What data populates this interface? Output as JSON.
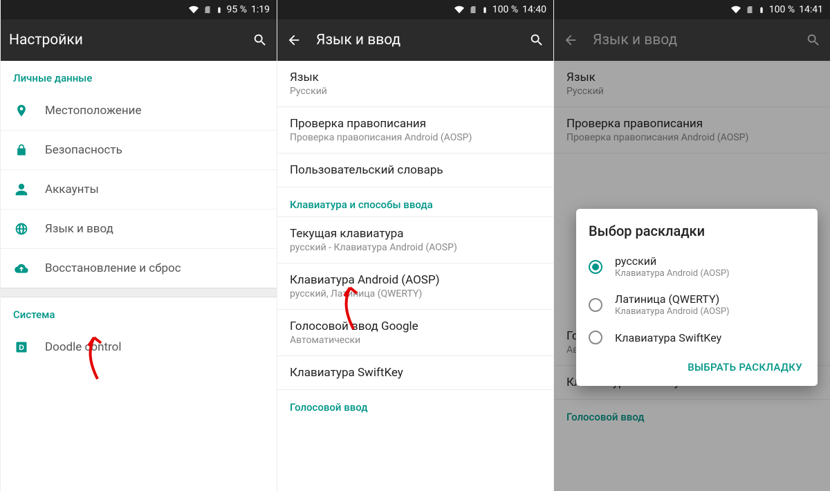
{
  "colors": {
    "accent": "#009688"
  },
  "screens": [
    {
      "status": {
        "battery": "95 %",
        "time": "1:19"
      },
      "appbar": {
        "title": "Настройки",
        "has_back": false
      },
      "section1_header": "Личные данные",
      "items1": [
        {
          "icon": "location",
          "label": "Местоположение"
        },
        {
          "icon": "lock",
          "label": "Безопасность"
        },
        {
          "icon": "account",
          "label": "Аккаунты"
        },
        {
          "icon": "globe",
          "label": "Язык и ввод"
        },
        {
          "icon": "backup",
          "label": "Восстановление и сброс"
        }
      ],
      "section2_header": "Система",
      "items2": [
        {
          "icon": "doodle",
          "label": "Doodle control"
        }
      ]
    },
    {
      "status": {
        "battery": "100 %",
        "time": "14:40"
      },
      "appbar": {
        "title": "Язык и ввод",
        "has_back": true
      },
      "prefs": [
        {
          "title": "Язык",
          "sub": "Русский"
        },
        {
          "title": "Проверка правописания",
          "sub": "Проверка правописания Android (AOSP)"
        },
        {
          "title": "Пользовательский словарь",
          "sub": ""
        }
      ],
      "section_kbd": "Клавиатура и способы ввода",
      "kbd_prefs": [
        {
          "title": "Текущая клавиатура",
          "sub": "русский - Клавиатура Android (AOSP)"
        },
        {
          "title": "Клавиатура Android (AOSP)",
          "sub": "русский, Латиница (QWERTY)"
        },
        {
          "title": "Голосовой ввод Google",
          "sub": "Автоматически"
        },
        {
          "title": "Клавиатура SwiftKey",
          "sub": ""
        }
      ],
      "bottom_header": "Голосовой ввод"
    },
    {
      "status": {
        "battery": "100 %",
        "time": "14:41"
      },
      "appbar": {
        "title": "Язык и ввод",
        "has_back": true
      },
      "prefs": [
        {
          "title": "Язык",
          "sub": "Русский"
        },
        {
          "title": "Проверка правописания",
          "sub": "Проверка правописания Android (AOSP)"
        }
      ],
      "kbd_prefs": [
        {
          "title": "Голосовой ввод Google",
          "sub": "Автоматически"
        },
        {
          "title": "Клавиатура SwiftKey",
          "sub": ""
        }
      ],
      "bottom_header": "Голосовой ввод",
      "dialog": {
        "title": "Выбор раскладки",
        "options": [
          {
            "label": "русский",
            "sub": "Клавиатура Android (AOSP)",
            "checked": true
          },
          {
            "label": "Латиница (QWERTY)",
            "sub": "Клавиатура Android (AOSP)",
            "checked": false
          },
          {
            "label": "Клавиатура SwiftKey",
            "sub": "",
            "checked": false
          }
        ],
        "action": "ВЫБРАТЬ РАСКЛАДКУ"
      }
    }
  ]
}
